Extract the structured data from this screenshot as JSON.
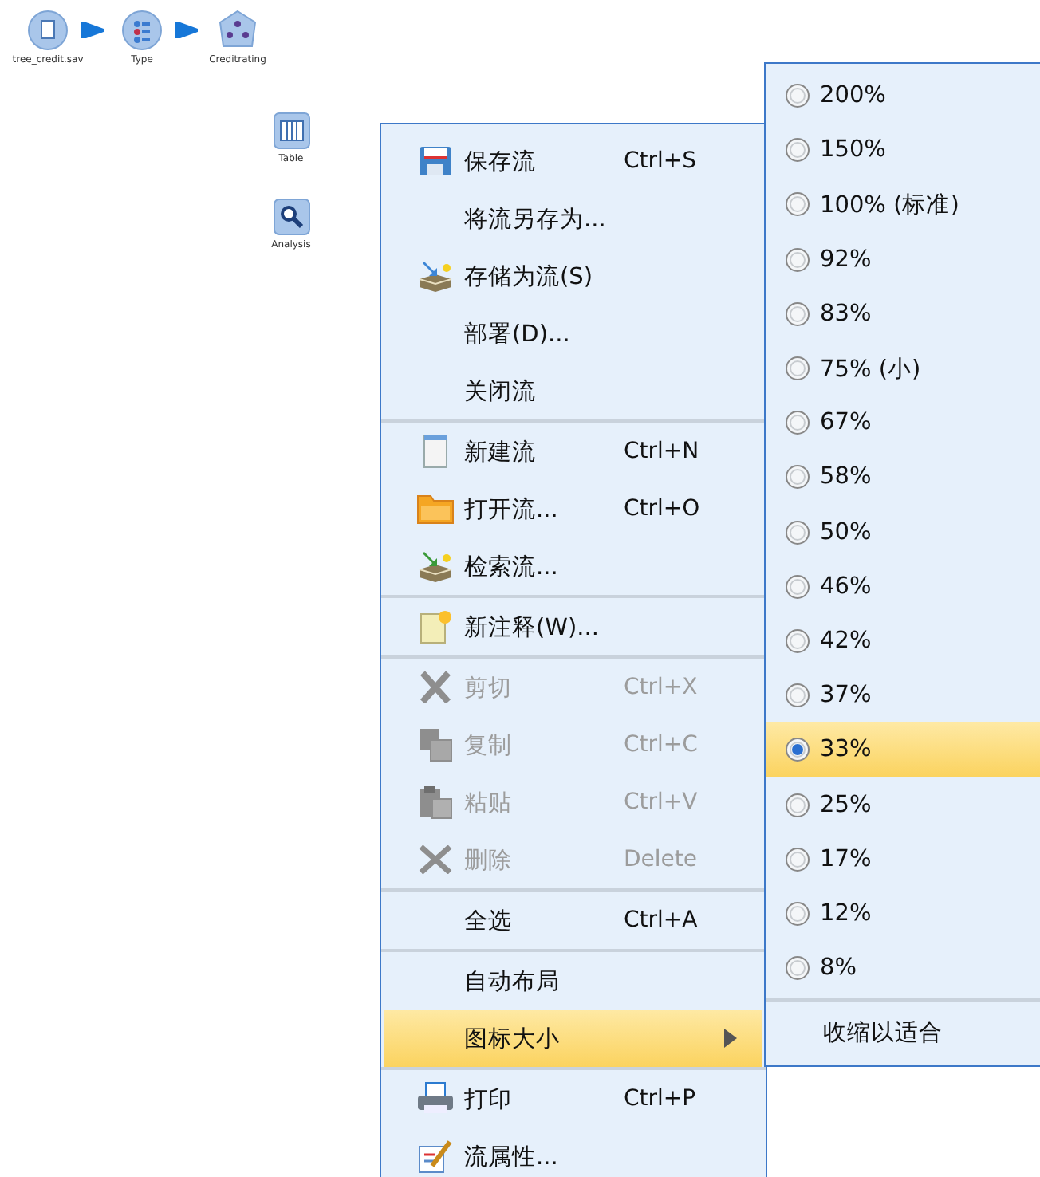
{
  "canvas": {
    "stream_nodes": [
      {
        "label": "tree_credit.sav"
      },
      {
        "label": "Type"
      },
      {
        "label": "Creditrating"
      }
    ],
    "output_nodes": [
      {
        "label": "Table"
      },
      {
        "label": "Analysis"
      }
    ]
  },
  "context_menu": {
    "groups": [
      {
        "items": [
          {
            "label": "保存流",
            "shortcut": "Ctrl+S",
            "disabled": false,
            "selected": false
          },
          {
            "label": "将流另存为...",
            "disabled": false,
            "selected": false
          },
          {
            "label": "存储为流(S)",
            "disabled": false,
            "selected": false
          },
          {
            "label": "部署(D)...",
            "disabled": false,
            "selected": false
          },
          {
            "label": "关闭流",
            "disabled": false,
            "selected": false
          }
        ]
      },
      {
        "items": [
          {
            "label": "新建流",
            "shortcut": "Ctrl+N",
            "disabled": false,
            "selected": false
          },
          {
            "label": "打开流...",
            "shortcut": "Ctrl+O",
            "disabled": false,
            "selected": false
          },
          {
            "label": "检索流...",
            "disabled": false,
            "selected": false
          }
        ]
      },
      {
        "items": [
          {
            "label": "新注释(W)...",
            "disabled": false,
            "selected": false
          }
        ]
      },
      {
        "items": [
          {
            "label": "剪切",
            "shortcut": "Ctrl+X",
            "disabled": true,
            "selected": false
          },
          {
            "label": "复制",
            "shortcut": "Ctrl+C",
            "disabled": true,
            "selected": false
          },
          {
            "label": "粘贴",
            "shortcut": "Ctrl+V",
            "disabled": true,
            "selected": false
          },
          {
            "label": "删除",
            "shortcut": "Delete",
            "disabled": true,
            "selected": false
          }
        ]
      },
      {
        "items": [
          {
            "label": "全选",
            "shortcut": "Ctrl+A",
            "disabled": false,
            "selected": false
          }
        ]
      },
      {
        "items": [
          {
            "label": "自动布局",
            "disabled": false,
            "selected": false
          },
          {
            "label": "图标大小",
            "disabled": false,
            "selected": true,
            "submenu": true
          }
        ]
      },
      {
        "items": [
          {
            "label": "打印",
            "shortcut": "Ctrl+P",
            "disabled": false,
            "selected": false
          },
          {
            "label": "流属性...",
            "disabled": false,
            "selected": false
          }
        ]
      }
    ]
  },
  "icon_size_submenu": {
    "options": [
      {
        "label": "200%",
        "selected": false
      },
      {
        "label": "150%",
        "selected": false
      },
      {
        "label": "100% (标准)",
        "selected": false
      },
      {
        "label": "92%",
        "selected": false
      },
      {
        "label": "83%",
        "selected": false
      },
      {
        "label": "75% (小)",
        "selected": false
      },
      {
        "label": "67%",
        "selected": false
      },
      {
        "label": "58%",
        "selected": false
      },
      {
        "label": "50%",
        "selected": false
      },
      {
        "label": "46%",
        "selected": false
      },
      {
        "label": "42%",
        "selected": false
      },
      {
        "label": "37%",
        "selected": false
      },
      {
        "label": "33%",
        "selected": true
      },
      {
        "label": "25%",
        "selected": false
      },
      {
        "label": "17%",
        "selected": false
      },
      {
        "label": "12%",
        "selected": false
      },
      {
        "label": "8%",
        "selected": false
      }
    ],
    "actions": [
      {
        "label": "收缩以适合"
      }
    ]
  }
}
